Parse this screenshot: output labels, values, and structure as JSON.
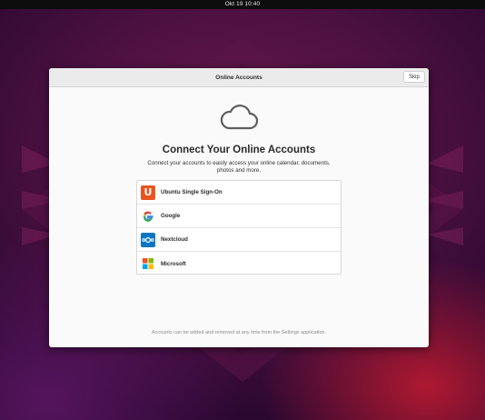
{
  "topbar": {
    "clock": "Okt 19  10:40"
  },
  "window": {
    "title": "Online Accounts",
    "skip_label": "Skip"
  },
  "main": {
    "icon": "cloud-icon",
    "title": "Connect Your Online Accounts",
    "subtitle": "Connect your accounts to easily access your online calendar, documents, photos and more."
  },
  "providers": [
    {
      "label": "Ubuntu Single Sign-On",
      "icon": "ubuntu-sso-icon",
      "color": "#e95420"
    },
    {
      "label": "Google",
      "icon": "google-icon"
    },
    {
      "label": "Nextcloud",
      "icon": "nextcloud-icon",
      "color": "#0a75c2"
    },
    {
      "label": "Microsoft",
      "icon": "microsoft-icon"
    }
  ],
  "footer": {
    "note": "Accounts can be added and removed at any time from the Settings application."
  }
}
